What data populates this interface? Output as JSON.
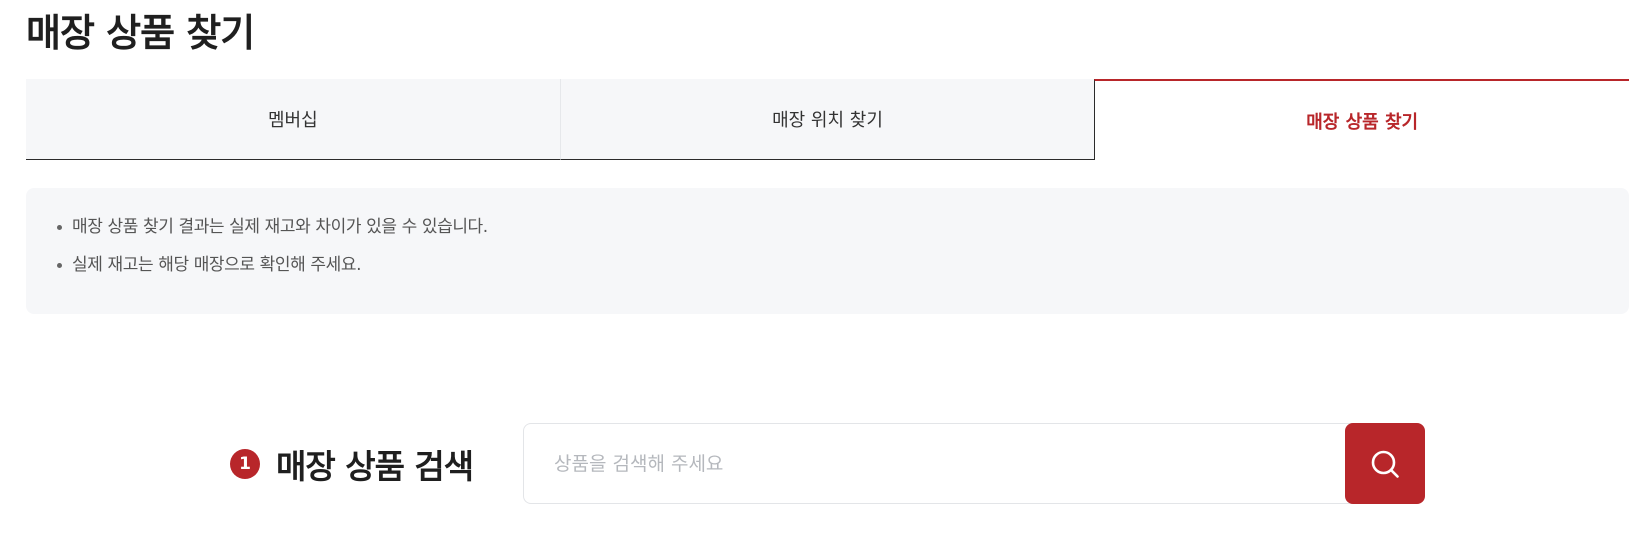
{
  "page": {
    "title": "매장 상품 찾기"
  },
  "tabs": [
    {
      "label": "멤버십",
      "active": false
    },
    {
      "label": "매장 위치 찾기",
      "active": false
    },
    {
      "label": "매장 상품 찾기",
      "active": true
    }
  ],
  "notice": {
    "items": [
      "매장 상품 찾기 결과는 실제 재고와 차이가 있을 수 있습니다.",
      "실제 재고는 해당 매장으로 확인해 주세요."
    ]
  },
  "search": {
    "step_number": "1",
    "title": "매장 상품 검색",
    "placeholder": "상품을 검색해 주세요",
    "value": "",
    "button_icon": "search-icon"
  },
  "colors": {
    "accent": "#b8262a",
    "tab_background": "#f6f7f9",
    "notice_background": "#f6f7f9",
    "placeholder": "#b5b8bd"
  }
}
